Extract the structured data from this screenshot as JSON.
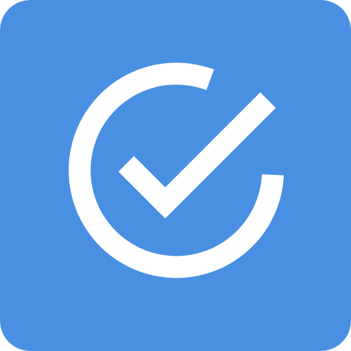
{
  "icon": {
    "name": "check-circle-icon",
    "background_color": "#4A90E2",
    "foreground_color": "#FFFFFF"
  }
}
